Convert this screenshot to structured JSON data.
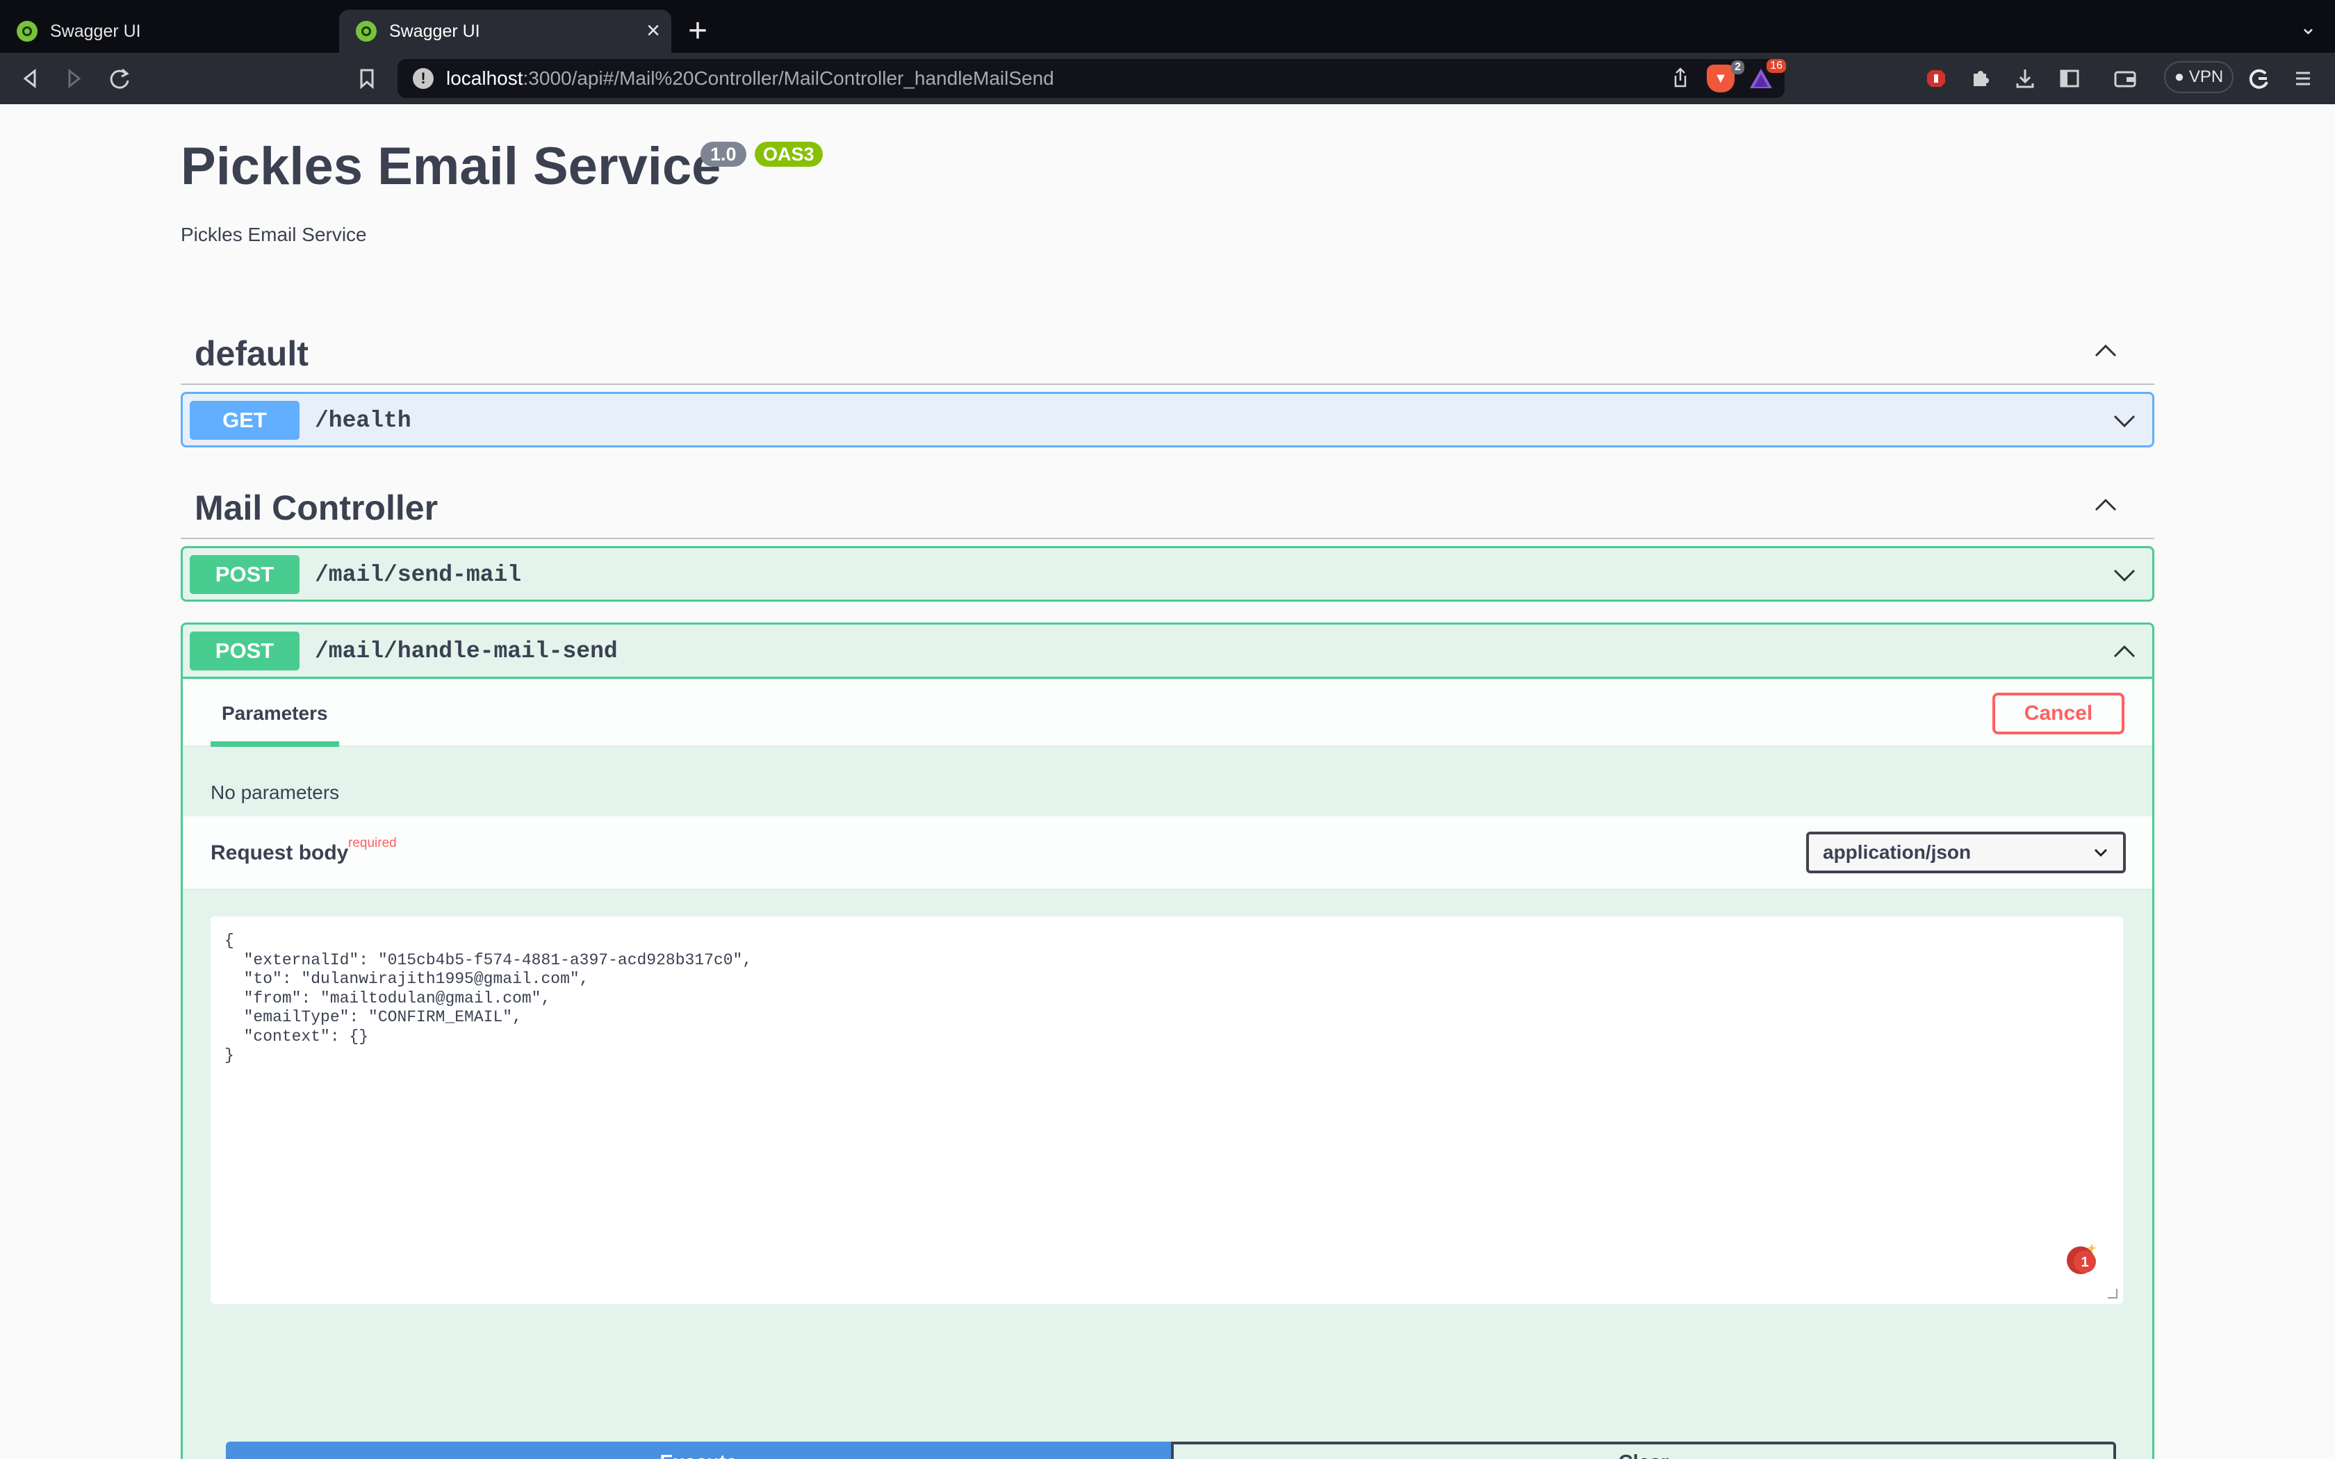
{
  "browser": {
    "tabs": [
      {
        "label": "Swagger UI",
        "icon": "swagger-favicon",
        "active": false
      },
      {
        "label": "Swagger UI",
        "icon": "swagger-favicon",
        "active": true
      }
    ],
    "url": {
      "host": "localhost",
      "rest": ":3000/api#/Mail%20Controller/MailController_handleMailSend"
    },
    "brave_shield_count": "2",
    "rewards_count": "16",
    "vpn_label": "VPN"
  },
  "api": {
    "title": "Pickles Email Service",
    "version": "1.0",
    "oas": "OAS3",
    "description": "Pickles Email Service"
  },
  "sections": {
    "default": {
      "name": "default",
      "operations": [
        {
          "method": "GET",
          "path": "/health"
        }
      ]
    },
    "mail": {
      "name": "Mail Controller",
      "operations": [
        {
          "method": "POST",
          "path": "/mail/send-mail"
        },
        {
          "method": "POST",
          "path": "/mail/handle-mail-send"
        }
      ]
    }
  },
  "expanded_op": {
    "parameters_tab": "Parameters",
    "cancel_label": "Cancel",
    "no_params": "No parameters",
    "request_body_label": "Request body",
    "required_label": "required",
    "content_type": "application/json",
    "body_lines": [
      "{",
      "  \"externalId\": \"015cb4b5-f574-4881-a397-acd928b317c0\",",
      "  \"to\": \"dulanwirajith1995@gmail.com\",",
      "  \"from\": \"mailtodulan@gmail.com\",",
      "  \"emailType\": \"CONFIRM_EMAIL\",",
      "  \"context\": {}",
      "}"
    ],
    "grammarly_count": "1",
    "execute_label": "Execute",
    "clear_label": "Clear"
  },
  "colors": {
    "get": "#61affe",
    "post": "#49cc90",
    "cancel": "#ff6060",
    "execute": "#4990e2",
    "oas": "#89bf04",
    "text": "#3b4151"
  }
}
